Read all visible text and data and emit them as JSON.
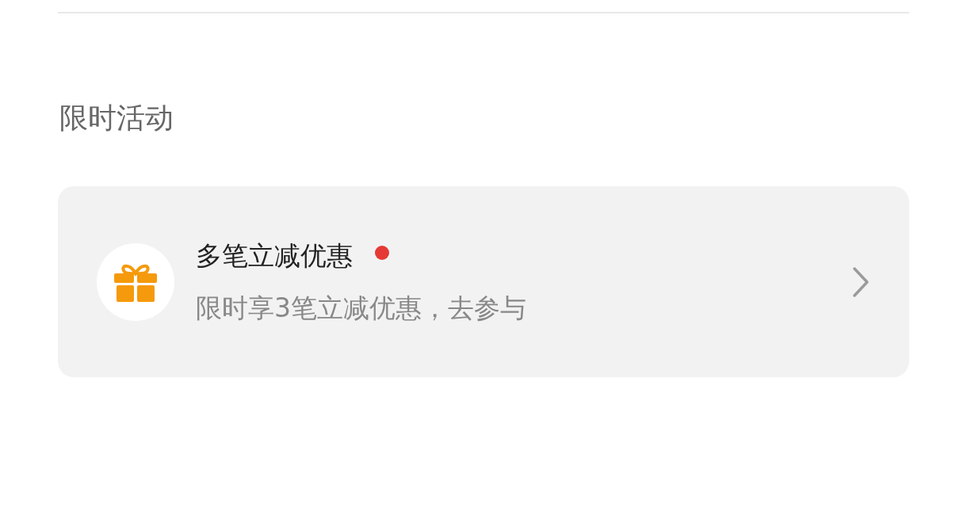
{
  "section_title": "限时活动",
  "activity": {
    "title": "多笔立减优惠",
    "unread": true,
    "subtitle": "限时享3笔立减优惠，去参与"
  }
}
